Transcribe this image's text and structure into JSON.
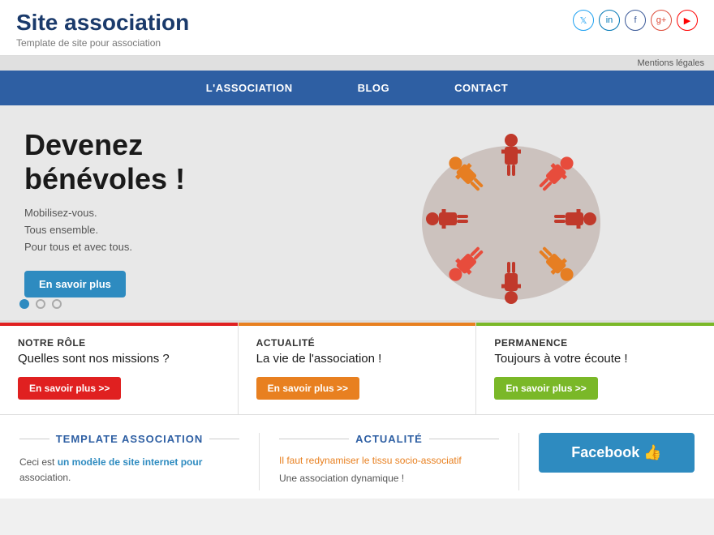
{
  "header": {
    "title": "Site association",
    "subtitle": "Template de site pour association",
    "mentions_label": "Mentions légales"
  },
  "social": {
    "twitter": "🐦",
    "linkedin": "in",
    "facebook": "f",
    "gplus": "g+",
    "youtube": "▶"
  },
  "nav": {
    "items": [
      {
        "label": "L'ASSOCIATION"
      },
      {
        "label": "BLOG"
      },
      {
        "label": "CONTACT"
      }
    ]
  },
  "hero": {
    "title": "Devenez bénévoles !",
    "subtitle_line1": "Mobilisez-vous.",
    "subtitle_line2": "Tous ensemble.",
    "subtitle_line3": "Pour tous et avec tous.",
    "btn_label": "En savoir plus"
  },
  "cards": [
    {
      "title": "NOTRE RÔLE",
      "desc": "Quelles sont nos missions ?",
      "btn": "En savoir plus >>",
      "color": "red"
    },
    {
      "title": "ACTUALITÉ",
      "desc": "La vie de l'association !",
      "btn": "En savoir plus >>",
      "color": "orange"
    },
    {
      "title": "PERMANENCE",
      "desc": "Toujours à votre écoute !",
      "btn": "En savoir plus >>",
      "color": "green"
    }
  ],
  "bottom": {
    "col1": {
      "section_title": "TEMPLATE ASSOCIATION",
      "text_plain": "Ceci est ",
      "text_link": "un modèle de site internet pour",
      "text_end": " association."
    },
    "col2": {
      "section_title": "ACTUALITÉ",
      "link1": "Il faut redynamiser le tissu socio-associatif",
      "link2": "Une association dynamique !"
    },
    "col3": {
      "fb_label": "Facebook 👍"
    }
  }
}
